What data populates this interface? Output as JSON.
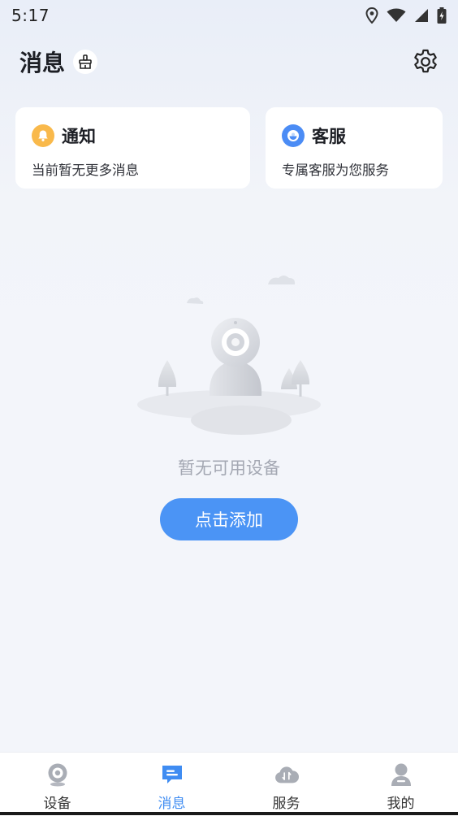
{
  "status_bar": {
    "time": "5:17"
  },
  "header": {
    "title": "消息"
  },
  "cards": {
    "notify": {
      "title": "通知",
      "subtitle": "当前暂无更多消息",
      "icon": "bell-icon",
      "color": "#f9b94b"
    },
    "service": {
      "title": "客服",
      "subtitle": "专属客服为您服务",
      "icon": "headset-icon",
      "color": "#4b8cf5"
    }
  },
  "empty_state": {
    "text": "暂无可用设备",
    "button_label": "点击添加"
  },
  "tabs": [
    {
      "label": "设备",
      "icon": "camera-icon"
    },
    {
      "label": "消息",
      "icon": "message-icon"
    },
    {
      "label": "服务",
      "icon": "cloud-service-icon"
    },
    {
      "label": "我的",
      "icon": "profile-icon"
    }
  ],
  "colors": {
    "accent": "#4b94f5",
    "active_tab": "#3f8cf2"
  }
}
